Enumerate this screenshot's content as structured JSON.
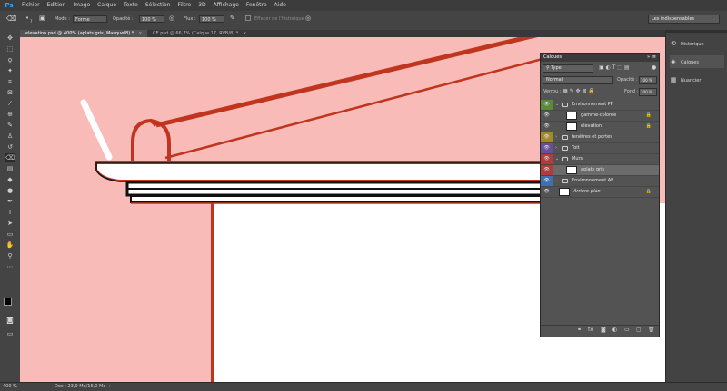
{
  "app": {
    "logo": "Ps"
  },
  "menu": [
    "Fichier",
    "Edition",
    "Image",
    "Calque",
    "Texte",
    "Sélection",
    "Filtre",
    "3D",
    "Affichage",
    "Fenêtre",
    "Aide"
  ],
  "options": {
    "mode_label": "Mode :",
    "mode_value": "Forme",
    "opacity_label": "Opacité :",
    "opacity_value": "100 %",
    "flow_label": "Flux :",
    "flow_value": "100 %",
    "history_label": "Effacer de l'historique",
    "brush_size": "7",
    "workspace": "Les indispensables"
  },
  "tabs": [
    {
      "label": "elevation.psd @ 400% (aplats gris, Masque/8) *",
      "active": true
    },
    {
      "label": "CE.psd @ 66,7% (Calque 17, RVB/8) *",
      "active": false
    }
  ],
  "dock": [
    {
      "label": "Historique",
      "icon": "history-icon"
    },
    {
      "label": "Calques",
      "icon": "layers-icon"
    },
    {
      "label": "Nuancier",
      "icon": "swatches-icon"
    }
  ],
  "layers_panel": {
    "title": "Calques",
    "filter": "Type",
    "blend": "Normal",
    "opacity_label": "Opacité :",
    "opacity_value": "100 %",
    "lock_label": "Verrou :",
    "fill_label": "Fond :",
    "fill_value": "100 %",
    "layers": [
      {
        "name": "Environnement PP",
        "type": "group",
        "color": "#5a8a3a",
        "indent": 0,
        "expanded": true,
        "locked": false,
        "selected": false
      },
      {
        "name": "gamme-coloree",
        "type": "layer",
        "color": "",
        "indent": 1,
        "locked": true,
        "selected": false
      },
      {
        "name": "elevation",
        "type": "layer",
        "color": "",
        "indent": 1,
        "locked": true,
        "selected": false
      },
      {
        "name": "fenêtres et portes",
        "type": "group",
        "color": "#a5882c",
        "indent": 0,
        "expanded": false,
        "locked": false,
        "selected": false
      },
      {
        "name": "Toit",
        "type": "group",
        "color": "#6a4e9e",
        "indent": 0,
        "expanded": false,
        "locked": false,
        "selected": false
      },
      {
        "name": "Murs",
        "type": "group",
        "color": "#b23b3b",
        "indent": 0,
        "expanded": true,
        "locked": false,
        "selected": false
      },
      {
        "name": "aplats gris",
        "type": "layer",
        "color": "#b23b3b",
        "indent": 1,
        "locked": false,
        "selected": true
      },
      {
        "name": "Environnement AP",
        "type": "group",
        "color": "#3f6fb0",
        "indent": 0,
        "expanded": true,
        "locked": false,
        "selected": false
      },
      {
        "name": "Arrière-plan",
        "type": "background",
        "color": "",
        "indent": 0,
        "locked": true,
        "selected": false
      }
    ],
    "footer_icons": [
      "link-icon",
      "fx-icon",
      "mask-icon",
      "adjustment-icon",
      "group-icon",
      "new-layer-icon",
      "trash-icon"
    ]
  },
  "status": {
    "zoom": "400 %",
    "doc": "Doc : 23,9 Mo/16,0 Mo"
  },
  "colors": {
    "canvas_pink": "#f8bbb8",
    "roof_red": "#c0351e",
    "accent_blue": "#31a8ff"
  }
}
